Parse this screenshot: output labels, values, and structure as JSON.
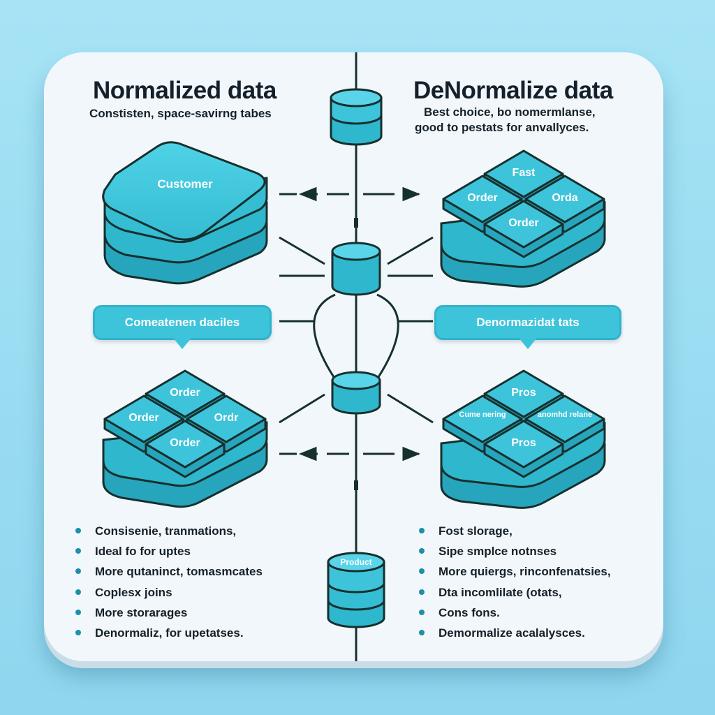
{
  "left": {
    "title": "Normalized data",
    "subtitle": "Constisten, space-savirng tabes",
    "callout": "Comeatenen daciles",
    "top_stack_label": "Customer",
    "bottom_tiles": [
      "Order",
      "Order",
      "Ordr",
      "Order"
    ],
    "bullets": [
      "Consisenie, tranmations,",
      "Ideal fo for uptes",
      "More qutaninct, tomasmcates",
      "Coplesx joins",
      "More storarages",
      "Denormaliz, for upetatses."
    ]
  },
  "right": {
    "title": "DeNormalize data",
    "subtitle_line1": "Best choice, bo nomermlanse,",
    "subtitle_line2": "good to pestats for anvallyces.",
    "callout": "Denormazidat tats",
    "top_tiles": [
      "Fast",
      "Order",
      "Orda",
      "Order"
    ],
    "bottom_tiles": [
      "Pros",
      "Cume nering",
      "anomhd relane",
      "Pros"
    ],
    "bullets": [
      "Fost slorage,",
      "Sipe smplce notnses",
      "More quiergs, rinconfenatsies,",
      "Dta incomlilate (otats,",
      "Cons fons.",
      "Demormalize acalalysces."
    ]
  },
  "center": {
    "product_label": "Product"
  },
  "colors": {
    "tile": "#3ec4da",
    "tile_dark": "#27a5bd",
    "outline": "#16302e",
    "card": "#f2f7fb"
  }
}
